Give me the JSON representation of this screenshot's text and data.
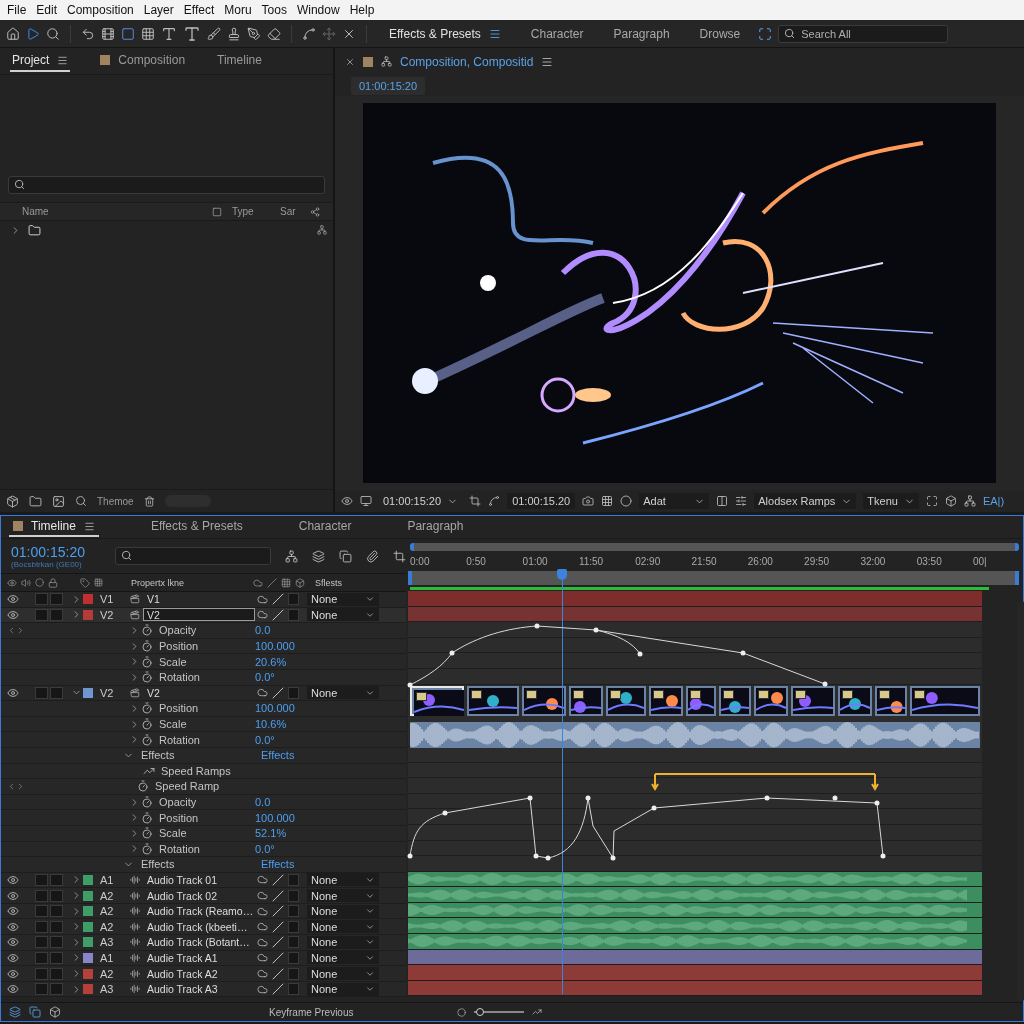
{
  "menu": [
    "File",
    "Edit",
    "Composition",
    "Layer",
    "Effect",
    "Moru",
    "Toos",
    "Window",
    "Help"
  ],
  "toolbar": {
    "tabs": [
      {
        "label": "Effects & Presets",
        "selected": true
      },
      {
        "label": "Character",
        "selected": false
      },
      {
        "label": "Paragraph",
        "selected": false
      },
      {
        "label": "Drowse",
        "selected": false
      }
    ],
    "search": {
      "placeholder": "Search All"
    }
  },
  "project": {
    "tabs": [
      {
        "label": "Project",
        "selected": true,
        "swatch": false
      },
      {
        "label": "Composition",
        "selected": false,
        "swatch": true
      },
      {
        "label": "Timeline",
        "selected": false,
        "swatch": false
      }
    ],
    "columns": [
      "Name",
      "Type",
      "Sar"
    ],
    "rows": [
      {
        "kind": "folder",
        "expanded": false
      }
    ],
    "footer_label": "Themoe"
  },
  "viewer": {
    "tab": "Composition, Compositid",
    "timecode": "01:00:15:20",
    "controls": [
      {
        "kind": "dropdown",
        "value": "01:00:15:20"
      },
      {
        "kind": "readout",
        "value": "01:00:15.20"
      },
      {
        "kind": "dropdown",
        "value": "Adat"
      },
      {
        "kind": "dropdown",
        "value": "Alodsex Ramps"
      },
      {
        "kind": "dropdown",
        "value": "Tkenu"
      },
      {
        "kind": "link",
        "value": "EA|)"
      }
    ]
  },
  "timeline": {
    "tabs": [
      {
        "label": "Timeline",
        "selected": true,
        "swatch": true
      },
      {
        "label": "Effects & Presets",
        "selected": false,
        "swatch": false
      },
      {
        "label": "Character",
        "selected": false,
        "swatch": false
      },
      {
        "label": "Paragraph",
        "selected": false,
        "swatch": false
      }
    ],
    "timecode": "01:00:15:20",
    "timecode_sub": "(Bocsbtrkan (GE00)",
    "header": {
      "name": "Propertx lkne",
      "effects": "Sflests"
    },
    "ruler": [
      "0:00",
      "0:50",
      "01:00",
      "11:50",
      "02:90",
      "21:50",
      "26:00",
      "29:50",
      "32:00",
      "03:50",
      "00|"
    ],
    "layers": [
      {
        "kind": "layer",
        "label": "V1",
        "name": "V1",
        "color": "#c0302e",
        "expanded": false,
        "editing": false,
        "mode": "None"
      },
      {
        "kind": "layer",
        "label": "V2",
        "name": "V2",
        "color": "#b53b36",
        "expanded": false,
        "editing": true,
        "mode": "None"
      },
      {
        "kind": "property",
        "name": "Opacity",
        "value": "0.0",
        "keyframe_nav": true
      },
      {
        "kind": "property",
        "name": "Position",
        "value": "100.000",
        "keyframe_nav": false
      },
      {
        "kind": "property",
        "name": "Scale",
        "value": "20.6%",
        "keyframe_nav": false
      },
      {
        "kind": "property",
        "name": "Rotation",
        "value": "0.0°",
        "keyframe_nav": false
      },
      {
        "kind": "clip_layer",
        "label": "V2",
        "name": "V2",
        "color": "#6f96d0",
        "expanded": true,
        "editing": false,
        "mode": "None"
      },
      {
        "kind": "property",
        "name": "Position",
        "value": "100.000",
        "keyframe_nav": false
      },
      {
        "kind": "property",
        "name": "Scale",
        "value": "10.6%",
        "keyframe_nav": false
      },
      {
        "kind": "property",
        "name": "Rotation",
        "value": "0.0°",
        "keyframe_nav": false
      },
      {
        "kind": "group",
        "name": "Effects",
        "value": "Effects",
        "expanded": true
      },
      {
        "kind": "effect",
        "name": "Speed Ramps"
      },
      {
        "kind": "stopwatch",
        "name": "Speed Ramp",
        "keyframe_nav": true
      },
      {
        "kind": "property",
        "name": "Opacity",
        "value": "0.0",
        "keyframe_nav": false
      },
      {
        "kind": "property",
        "name": "Position",
        "value": "100.000",
        "keyframe_nav": false
      },
      {
        "kind": "property",
        "name": "Scale",
        "value": "52.1%",
        "keyframe_nav": false
      },
      {
        "kind": "property",
        "name": "Rotation",
        "value": "0.0°",
        "keyframe_nav": false
      },
      {
        "kind": "group",
        "name": "Effects",
        "value": "Effects",
        "expanded": true
      },
      {
        "kind": "audio",
        "label": "A1",
        "name": "Audio Track 01",
        "color": "#3f9e68",
        "expanded": false,
        "editing": false,
        "mode": "None",
        "waveform": true
      },
      {
        "kind": "audio",
        "label": "A2",
        "name": "Audio Track 02",
        "color": "#3f9e68",
        "expanded": false,
        "editing": false,
        "mode": "None",
        "waveform": true
      },
      {
        "kind": "audio",
        "label": "A2",
        "name": "Audio Track (Reamo…",
        "color": "#3f9e68",
        "expanded": false,
        "editing": false,
        "mode": "None",
        "waveform": true
      },
      {
        "kind": "audio",
        "label": "A2",
        "name": "Audio Track (kbeeti…",
        "color": "#3f9e68",
        "expanded": false,
        "editing": false,
        "mode": "None",
        "waveform": true
      },
      {
        "kind": "audio",
        "label": "A3",
        "name": "Audio Track (Botant…",
        "color": "#3f9e68",
        "expanded": false,
        "editing": false,
        "mode": "None",
        "waveform": true
      },
      {
        "kind": "audio",
        "label": "A1",
        "name": "Audie Track A1",
        "color": "#8886c8",
        "expanded": false,
        "editing": false,
        "mode": "None",
        "waveform": false
      },
      {
        "kind": "audio",
        "label": "A2",
        "name": "Audio Track A2",
        "color": "#b8403a",
        "expanded": false,
        "editing": false,
        "mode": "None",
        "waveform": false
      },
      {
        "kind": "audio",
        "label": "A3",
        "name": "Audio Track A3",
        "color": "#b8403a",
        "expanded": false,
        "editing": false,
        "mode": "None",
        "waveform": false
      }
    ],
    "footer": {
      "label": "Keyframe Previous",
      "zoom": {
        "level": 0.05
      }
    }
  }
}
